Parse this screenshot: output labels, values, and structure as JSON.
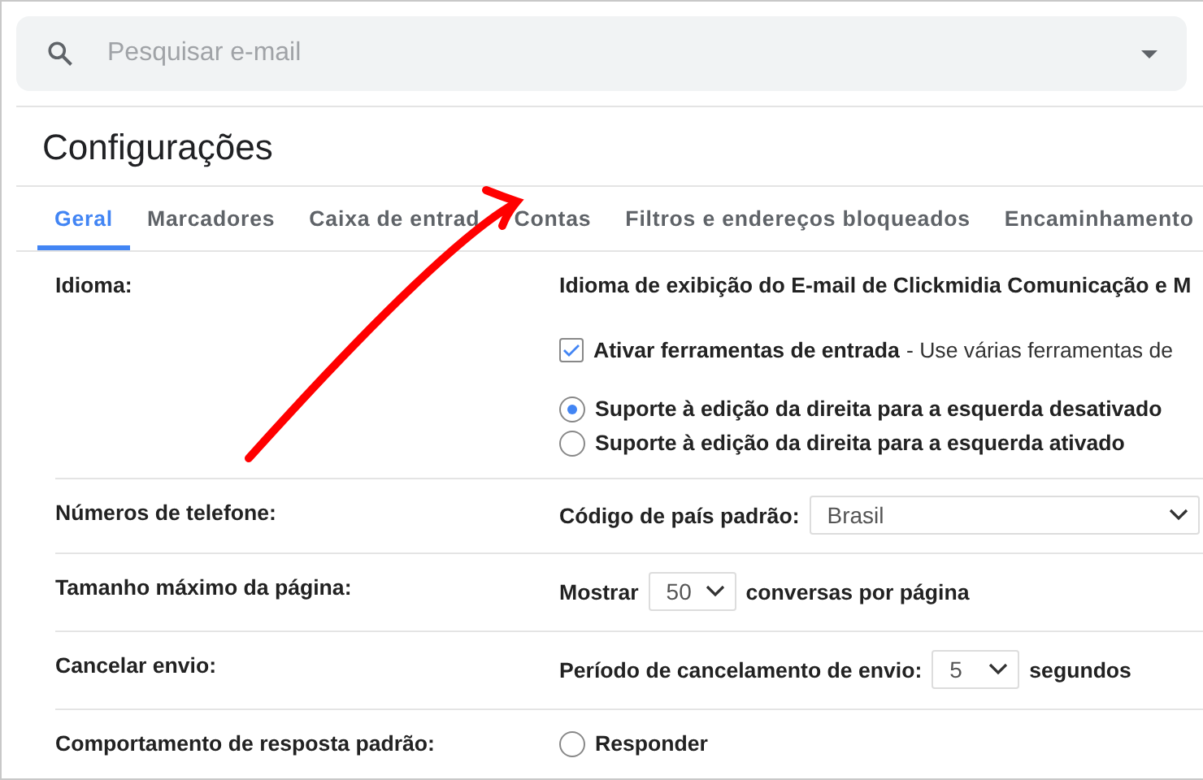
{
  "search": {
    "placeholder": "Pesquisar e-mail"
  },
  "title": "Configurações",
  "tabs": [
    {
      "label": "Geral",
      "selected": true
    },
    {
      "label": "Marcadores",
      "selected": false
    },
    {
      "label": "Caixa de entrad",
      "selected": false
    },
    {
      "label": "Contas",
      "selected": false
    },
    {
      "label": "Filtros e endereços bloqueados",
      "selected": false
    },
    {
      "label": "Encaminhamento",
      "selected": false
    }
  ],
  "settings": [
    {
      "label": "Idioma:",
      "items": [
        {
          "kind": "heading",
          "text": "Idioma de exibição do E-mail de Clickmidia Comunicação e M"
        },
        {
          "kind": "checkbox",
          "text": "Ativar ferramentas de entrada",
          "note": "- Use várias ferramentas de",
          "checked": true
        },
        {
          "kind": "radio",
          "text": "Suporte à edição da direita para a esquerda desativado",
          "selected": true
        },
        {
          "kind": "radio",
          "text": "Suporte à edição da direita para a esquerda ativado",
          "selected": false
        }
      ]
    },
    {
      "label": "Números de telefone:",
      "items": [
        {
          "kind": "wide-select",
          "prefix": "Código de país padrão:",
          "value": "Brasil"
        }
      ]
    },
    {
      "label": "Tamanho máximo da página:",
      "items": [
        {
          "kind": "inline-select",
          "prefix": "Mostrar",
          "value": "50",
          "suffix": "conversas por página"
        }
      ]
    },
    {
      "label": "Cancelar envio:",
      "items": [
        {
          "kind": "inline-select",
          "prefix": "Período de cancelamento de envio:",
          "value": "5",
          "suffix": "segundos"
        }
      ]
    },
    {
      "label": "Comportamento de resposta padrão:",
      "items": [
        {
          "kind": "radio",
          "text": "Responder",
          "selected": false
        }
      ]
    }
  ]
}
